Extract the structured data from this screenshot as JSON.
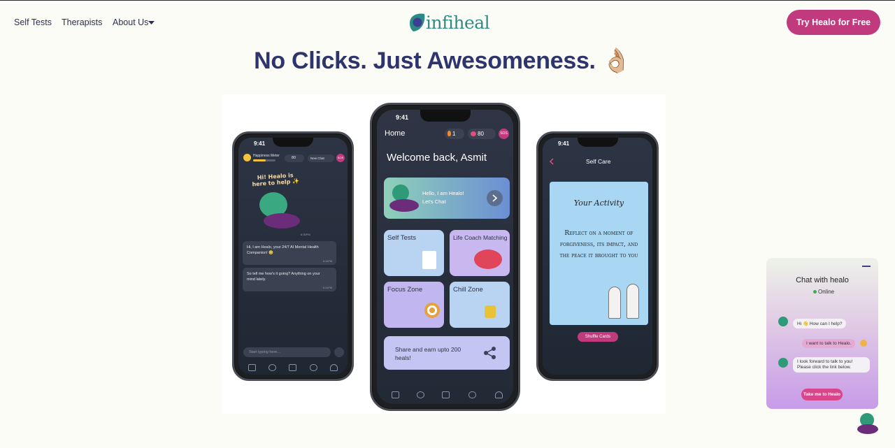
{
  "nav": {
    "items": [
      "Self Tests",
      "Therapists",
      "About Us"
    ],
    "logo_text": "infiheal",
    "cta": "Try Healo for Free"
  },
  "headline": "No Clicks. Just Awesomeness. 👌🏼",
  "phone_left": {
    "time": "9:41",
    "meter_label": "Happiness Meter",
    "hearts": "80",
    "new_chat": "New Chat",
    "sos": "SOS",
    "sticker_text": "Hi! Healo is here to help ✨",
    "sticker_time": "6:30PM",
    "msg1": "Hi, I am Healo, your 24/7 AI Mental Health Companion! 😊",
    "msg1_time": "6:31PM",
    "msg2": "So tell me how's it going? Anything on your mind lately.",
    "msg2_time": "6:31PM",
    "input_placeholder": "Start typing here..."
  },
  "phone_center": {
    "time": "9:41",
    "title": "Home",
    "streak": "1",
    "hearts": "80",
    "sos": "SOS",
    "welcome": "Welcome back, Asmit",
    "banner_line1": "Hello, I am Healo!",
    "banner_line2": "Let's Chat",
    "tiles": [
      "Self Tests",
      "Life Coach Matching",
      "Focus Zone",
      "Chill Zone"
    ],
    "share": "Share and earn upto 200 heals!"
  },
  "phone_right": {
    "time": "9:41",
    "title": "Self Care",
    "card_title": "Your Activity",
    "card_body": "Reflect on a moment of forgiveness, its impact, and the peace it brought to you",
    "button": "Shuffle Cards"
  },
  "chat_widget": {
    "title": "Chat with healo",
    "status": "Online",
    "m1": "Hi 👋 How can I help?",
    "m2": "I want to talk to Healo.",
    "m3": "I look forward to talk to you! Please click the link below.",
    "button": "Take me to Healo"
  },
  "colors": {
    "accent": "#c23a7e",
    "navy": "#2e356e",
    "teal": "#2f8a86"
  }
}
